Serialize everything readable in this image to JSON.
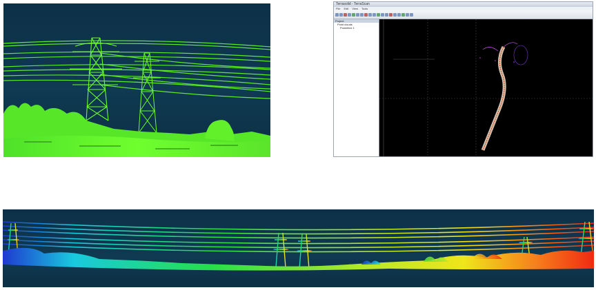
{
  "app_window": {
    "title": "Terrasolid - TerraScan",
    "menu": [
      "File",
      "Edit",
      "View",
      "Tools"
    ],
    "tree": {
      "header": "Project",
      "items": [
        "Point clouds",
        "Powerline 1"
      ]
    },
    "toolbar_icons": [
      "open-icon",
      "save-icon",
      "zoom-icon",
      "pan-icon",
      "rotate-icon",
      "select-icon",
      "measure-icon",
      "classify-icon"
    ]
  },
  "colors": {
    "pointcloud_green": "#66ff22",
    "background_navy": "#0d3048",
    "viewport_black": "#000000",
    "gradient_stops": [
      "#1f3ad0",
      "#19c9e0",
      "#25e04a",
      "#f0e51b",
      "#f7801c",
      "#ef2b12"
    ]
  }
}
